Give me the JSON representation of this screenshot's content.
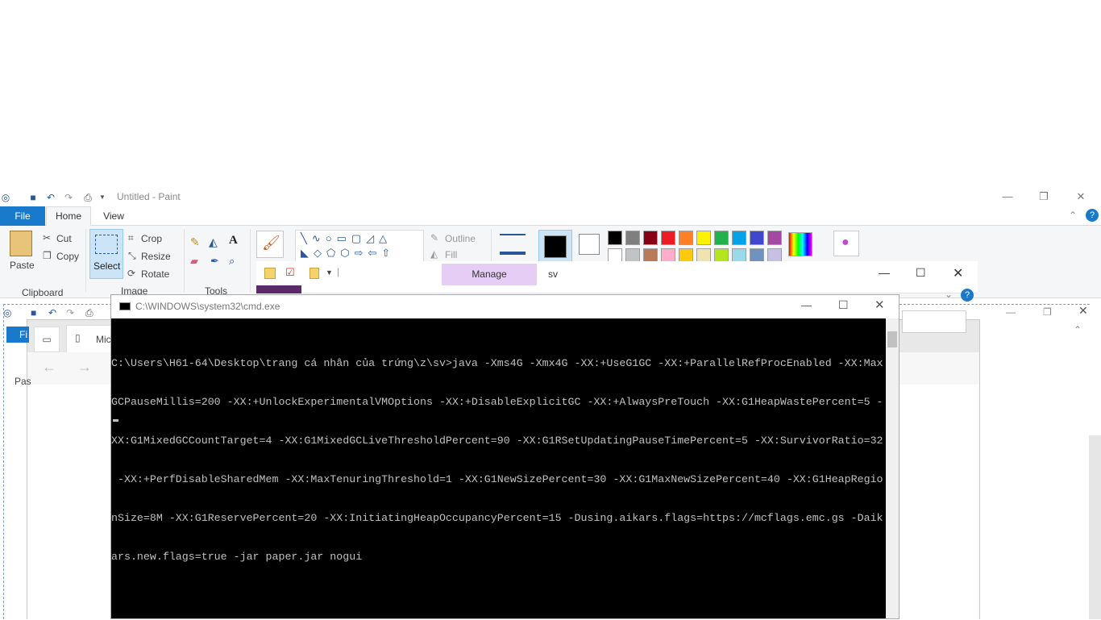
{
  "paint": {
    "title": "Untitled - Paint",
    "tabs": {
      "file": "File",
      "home": "Home",
      "view": "View"
    },
    "clipboard": {
      "paste": "Paste",
      "cut": "Cut",
      "copy": "Copy",
      "group": "Clipboard"
    },
    "image": {
      "select": "Select",
      "crop": "Crop",
      "resize": "Resize",
      "rotate": "Rotate",
      "group": "Image"
    },
    "tools_group": "Tools",
    "shapes": {
      "outline": "Outline",
      "fill": "Fill"
    },
    "colors": [
      "#000000",
      "#7f7f7f",
      "#880015",
      "#ed1c24",
      "#ff7f27",
      "#fff200",
      "#22b14c",
      "#00a2e8",
      "#3f48cc",
      "#a349a4",
      "#ffffff",
      "#c3c3c3",
      "#b97a57",
      "#ffaec9",
      "#ffc90e",
      "#efe4b0",
      "#b5e61d",
      "#99d9ea",
      "#7092be",
      "#c8bfe7"
    ],
    "color1": "#000000",
    "color2": "#ffffff"
  },
  "explorer": {
    "tab_label": "Mic"
  },
  "manage": {
    "tab": "Manage",
    "folder": "sv"
  },
  "paint2": {
    "file_tab": "Fi",
    "paste": "Pas"
  },
  "cmd": {
    "title": "C:\\WINDOWS\\system32\\cmd.exe",
    "lines": [
      "C:\\Users\\H61-64\\Desktop\\trang cá nhân của trứng\\z\\sv>java -Xms4G -Xmx4G -XX:+UseG1GC -XX:+ParallelRefProcEnabled -XX:Max",
      "GCPauseMillis=200 -XX:+UnlockExperimentalVMOptions -XX:+DisableExplicitGC -XX:+AlwaysPreTouch -XX:G1HeapWastePercent=5 -",
      "XX:G1MixedGCCountTarget=4 -XX:G1MixedGCLiveThresholdPercent=90 -XX:G1RSetUpdatingPauseTimePercent=5 -XX:SurvivorRatio=32",
      " -XX:+PerfDisableSharedMem -XX:MaxTenuringThreshold=1 -XX:G1NewSizePercent=30 -XX:G1MaxNewSizePercent=40 -XX:G1HeapRegio",
      "nSize=8M -XX:G1ReservePercent=20 -XX:InitiatingHeapOccupancyPercent=15 -Dusing.aikars.flags=https://mcflags.emc.gs -Daik",
      "ars.new.flags=true -jar paper.jar nogui"
    ]
  }
}
